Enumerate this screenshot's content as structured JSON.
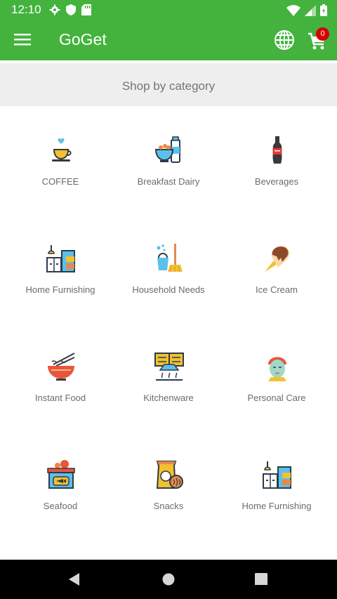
{
  "status_bar": {
    "time": "12:10",
    "left_icons": [
      "gear-icon",
      "shield-icon",
      "sd-card-icon"
    ],
    "right_icons": [
      "wifi-icon",
      "signal-icon",
      "battery-icon"
    ]
  },
  "app_bar": {
    "title": "GoGet",
    "cart_count": "0",
    "color": "#43b33d"
  },
  "section": {
    "title": "Shop by category"
  },
  "categories": [
    {
      "label": "COFFEE",
      "icon": "coffee-cup-icon"
    },
    {
      "label": "Breakfast Dairy",
      "icon": "breakfast-dairy-icon"
    },
    {
      "label": "Beverages",
      "icon": "soda-bottle-icon"
    },
    {
      "label": "Home Furnishing",
      "icon": "furniture-icon"
    },
    {
      "label": "Household Needs",
      "icon": "bucket-broom-icon"
    },
    {
      "label": "Ice Cream",
      "icon": "ice-cream-icon"
    },
    {
      "label": "Instant Food",
      "icon": "noodle-bowl-icon"
    },
    {
      "label": "Kitchenware",
      "icon": "kitchen-hood-icon"
    },
    {
      "label": "Personal Care",
      "icon": "face-mask-icon"
    },
    {
      "label": "Seafood",
      "icon": "fish-basket-icon"
    },
    {
      "label": "Snacks",
      "icon": "snack-bag-icon"
    },
    {
      "label": "Home Furnishing",
      "icon": "furniture-icon"
    }
  ],
  "nav_bar": {
    "buttons": [
      "back-icon",
      "home-icon",
      "recents-icon"
    ]
  }
}
